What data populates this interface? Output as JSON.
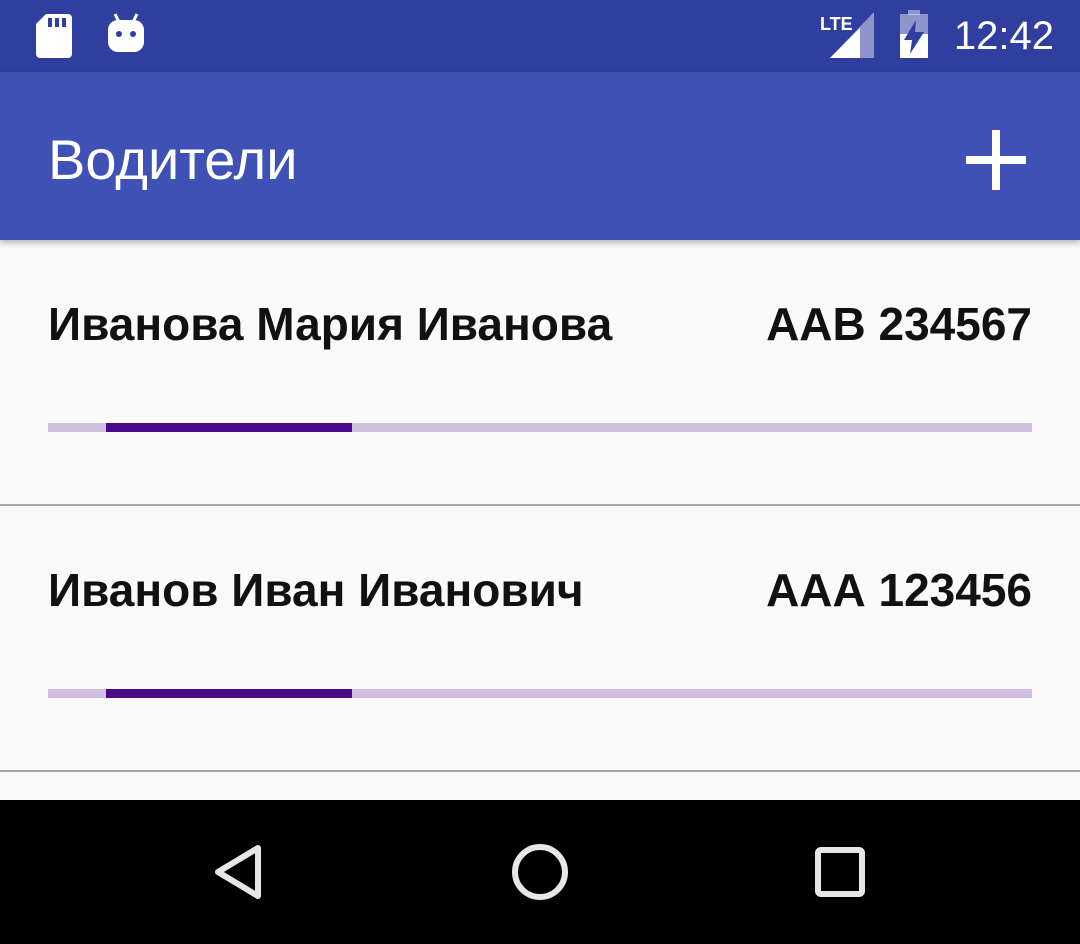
{
  "status_bar": {
    "time": "12:42",
    "network_label": "LTE",
    "icons": [
      "sd-card-icon",
      "android-debug-icon",
      "lte-signal-icon",
      "battery-charging-icon"
    ]
  },
  "app_bar": {
    "title": "Водители",
    "action_icon": "add-icon"
  },
  "drivers": [
    {
      "name": "Иванова Мария Иванова",
      "plate": "ААВ 234567",
      "progress": {
        "start": 0.059,
        "end": 0.309
      }
    },
    {
      "name": "Иванов Иван Иванович",
      "plate": "ААА 123456",
      "progress": {
        "start": 0.059,
        "end": 0.309
      }
    }
  ],
  "nav_bar": {
    "icons": [
      "back-icon",
      "home-icon",
      "recents-icon"
    ]
  },
  "colors": {
    "status_bar": "#303f9f",
    "app_bar": "#3f51b5",
    "progress_track": "#d1bfdf",
    "progress_fill": "#4a0a87"
  }
}
